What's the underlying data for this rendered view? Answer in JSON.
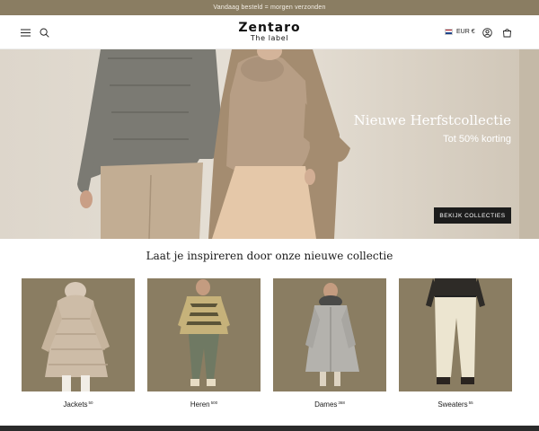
{
  "announcement": "Vandaag besteld = morgen verzonden",
  "header": {
    "brand_name": "Zentaro",
    "brand_sub": "The label",
    "currency": "EUR €"
  },
  "hero": {
    "title": "Nieuwe Herfstcollectie",
    "subtitle": "Tot 50% korting",
    "button_label": "BEKIJK COLLECTIES"
  },
  "section_title": "Laat je inspireren door onze nieuwe collectie",
  "categories": [
    {
      "label": "Jackets",
      "count": "50"
    },
    {
      "label": "Heren",
      "count": "500"
    },
    {
      "label": "Dames",
      "count": "368"
    },
    {
      "label": "Sweaters",
      "count": "55"
    }
  ],
  "colors": {
    "brand_taupe": "#8a7d62",
    "button_dark": "#1c1c1c",
    "hero_bg": "#e3ddd2"
  },
  "icons": [
    "menu-icon",
    "search-icon",
    "flag-nl-icon",
    "account-icon",
    "cart-icon"
  ]
}
